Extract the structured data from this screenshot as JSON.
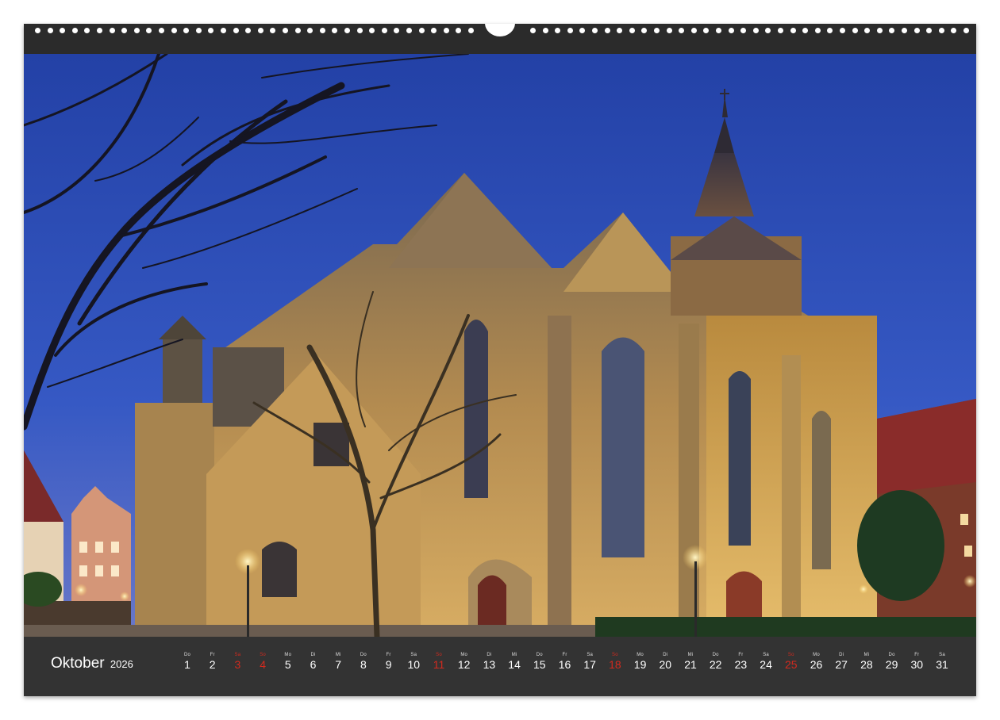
{
  "calendar": {
    "month": "Oktober",
    "year": "2026",
    "days": [
      {
        "weekday": "Do",
        "day": "1",
        "holiday": false
      },
      {
        "weekday": "Fr",
        "day": "2",
        "holiday": false
      },
      {
        "weekday": "Sa",
        "day": "3",
        "holiday": true
      },
      {
        "weekday": "So",
        "day": "4",
        "holiday": true
      },
      {
        "weekday": "Mo",
        "day": "5",
        "holiday": false
      },
      {
        "weekday": "Di",
        "day": "6",
        "holiday": false
      },
      {
        "weekday": "Mi",
        "day": "7",
        "holiday": false
      },
      {
        "weekday": "Do",
        "day": "8",
        "holiday": false
      },
      {
        "weekday": "Fr",
        "day": "9",
        "holiday": false
      },
      {
        "weekday": "Sa",
        "day": "10",
        "holiday": false
      },
      {
        "weekday": "So",
        "day": "11",
        "holiday": true
      },
      {
        "weekday": "Mo",
        "day": "12",
        "holiday": false
      },
      {
        "weekday": "Di",
        "day": "13",
        "holiday": false
      },
      {
        "weekday": "Mi",
        "day": "14",
        "holiday": false
      },
      {
        "weekday": "Do",
        "day": "15",
        "holiday": false
      },
      {
        "weekday": "Fr",
        "day": "16",
        "holiday": false
      },
      {
        "weekday": "Sa",
        "day": "17",
        "holiday": false
      },
      {
        "weekday": "So",
        "day": "18",
        "holiday": true
      },
      {
        "weekday": "Mo",
        "day": "19",
        "holiday": false
      },
      {
        "weekday": "Di",
        "day": "20",
        "holiday": false
      },
      {
        "weekday": "Mi",
        "day": "21",
        "holiday": false
      },
      {
        "weekday": "Do",
        "day": "22",
        "holiday": false
      },
      {
        "weekday": "Fr",
        "day": "23",
        "holiday": false
      },
      {
        "weekday": "Sa",
        "day": "24",
        "holiday": false
      },
      {
        "weekday": "So",
        "day": "25",
        "holiday": true
      },
      {
        "weekday": "Mo",
        "day": "26",
        "holiday": false
      },
      {
        "weekday": "Di",
        "day": "27",
        "holiday": false
      },
      {
        "weekday": "Mi",
        "day": "28",
        "holiday": false
      },
      {
        "weekday": "Do",
        "day": "29",
        "holiday": false
      },
      {
        "weekday": "Fr",
        "day": "30",
        "holiday": false
      },
      {
        "weekday": "Sa",
        "day": "31",
        "holiday": false
      }
    ]
  },
  "colors": {
    "frame": "#2f2f2f",
    "day_text": "#ffffff",
    "holiday_text": "#d42a1e",
    "sky": "#2a47a8",
    "stone_lit": "#c9a05a"
  }
}
